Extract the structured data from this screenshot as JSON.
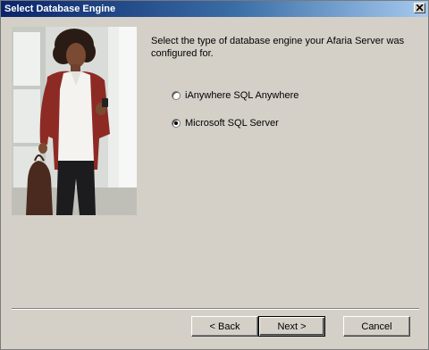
{
  "window": {
    "title": "Select Database Engine"
  },
  "icons": {
    "close": "close-icon",
    "photo": "woman-with-phone-photo"
  },
  "content": {
    "prompt": "Select the type of database engine your Afaria Server was configured for."
  },
  "options": [
    {
      "label": "iAnywhere SQL Anywhere",
      "selected": false
    },
    {
      "label": "Microsoft SQL Server",
      "selected": true
    }
  ],
  "buttons": {
    "back": "< Back",
    "next": "Next >",
    "cancel": "Cancel"
  },
  "colors": {
    "dialog_bg": "#d4d0c8",
    "title_gradient_start": "#0a246a",
    "title_gradient_end": "#a6caf0"
  }
}
